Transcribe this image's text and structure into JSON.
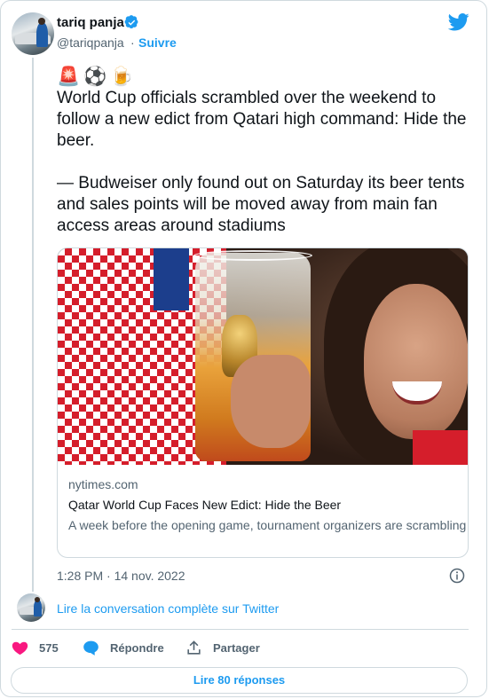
{
  "author": {
    "name": "tariq panja",
    "handle": "@tariqpanja",
    "separator": "·",
    "follow_label": "Suivre",
    "verified": true
  },
  "tweet": {
    "emojis": "🚨⚽🍺",
    "paragraph_1": "World Cup officials scrambled over the weekend to follow a new edict from Qatari high command: Hide the beer.",
    "paragraph_2": "— Budweiser only found out on Saturday its beer tents and sales points will be moved away from main fan access areas around stadiums",
    "timestamp": "1:28 PM · 14 nov. 2022"
  },
  "link_card": {
    "domain": "nytimes.com",
    "title": "Qatar World Cup Faces New Edict: Hide the Beer",
    "description": "A week before the opening game, tournament organizers are scrambling to balance late changes ordered by powerful Qatari ..."
  },
  "conversation": {
    "read_label": "Lire la conversation complète sur Twitter"
  },
  "actions": {
    "like_count": "575",
    "reply_label": "Répondre",
    "share_label": "Partager",
    "more_replies_label": "Lire 80 réponses"
  },
  "colors": {
    "accent": "#1d9bf0",
    "like": "#f91880",
    "text": "#0f1419",
    "muted": "#536471",
    "border": "#cfd9de"
  },
  "icons": [
    "verified-badge-icon",
    "twitter-bird-icon",
    "info-icon",
    "heart-icon",
    "reply-bubble-icon",
    "share-icon"
  ]
}
